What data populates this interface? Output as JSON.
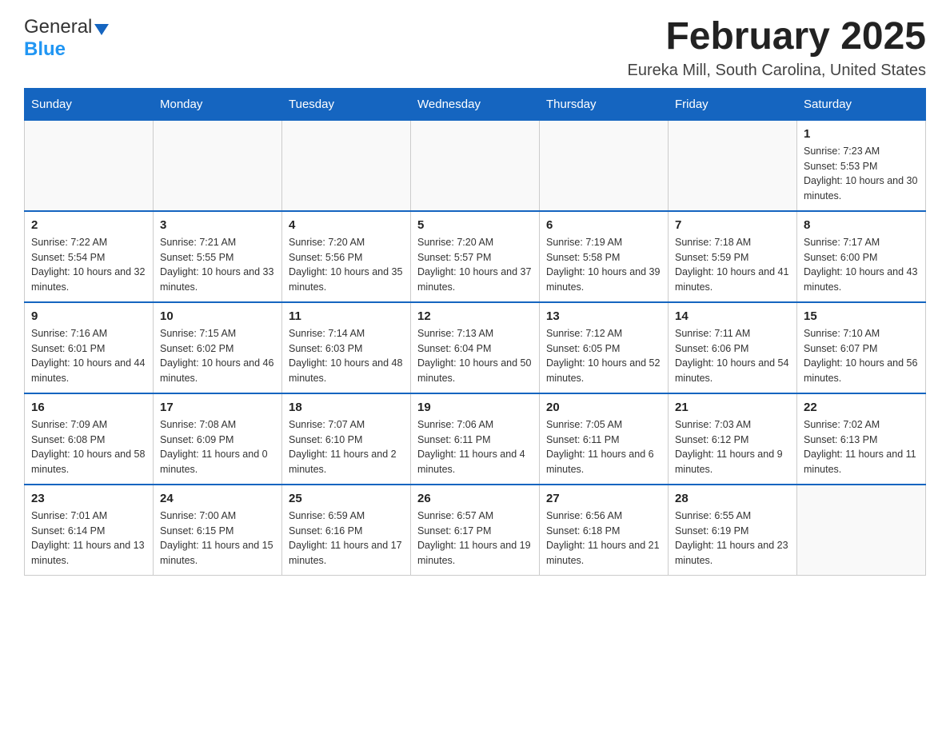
{
  "header": {
    "month_title": "February 2025",
    "location": "Eureka Mill, South Carolina, United States",
    "logo_general": "General",
    "logo_blue": "Blue"
  },
  "weekdays": [
    "Sunday",
    "Monday",
    "Tuesday",
    "Wednesday",
    "Thursday",
    "Friday",
    "Saturday"
  ],
  "weeks": [
    [
      {
        "day": "",
        "sunrise": "",
        "sunset": "",
        "daylight": ""
      },
      {
        "day": "",
        "sunrise": "",
        "sunset": "",
        "daylight": ""
      },
      {
        "day": "",
        "sunrise": "",
        "sunset": "",
        "daylight": ""
      },
      {
        "day": "",
        "sunrise": "",
        "sunset": "",
        "daylight": ""
      },
      {
        "day": "",
        "sunrise": "",
        "sunset": "",
        "daylight": ""
      },
      {
        "day": "",
        "sunrise": "",
        "sunset": "",
        "daylight": ""
      },
      {
        "day": "1",
        "sunrise": "Sunrise: 7:23 AM",
        "sunset": "Sunset: 5:53 PM",
        "daylight": "Daylight: 10 hours and 30 minutes."
      }
    ],
    [
      {
        "day": "2",
        "sunrise": "Sunrise: 7:22 AM",
        "sunset": "Sunset: 5:54 PM",
        "daylight": "Daylight: 10 hours and 32 minutes."
      },
      {
        "day": "3",
        "sunrise": "Sunrise: 7:21 AM",
        "sunset": "Sunset: 5:55 PM",
        "daylight": "Daylight: 10 hours and 33 minutes."
      },
      {
        "day": "4",
        "sunrise": "Sunrise: 7:20 AM",
        "sunset": "Sunset: 5:56 PM",
        "daylight": "Daylight: 10 hours and 35 minutes."
      },
      {
        "day": "5",
        "sunrise": "Sunrise: 7:20 AM",
        "sunset": "Sunset: 5:57 PM",
        "daylight": "Daylight: 10 hours and 37 minutes."
      },
      {
        "day": "6",
        "sunrise": "Sunrise: 7:19 AM",
        "sunset": "Sunset: 5:58 PM",
        "daylight": "Daylight: 10 hours and 39 minutes."
      },
      {
        "day": "7",
        "sunrise": "Sunrise: 7:18 AM",
        "sunset": "Sunset: 5:59 PM",
        "daylight": "Daylight: 10 hours and 41 minutes."
      },
      {
        "day": "8",
        "sunrise": "Sunrise: 7:17 AM",
        "sunset": "Sunset: 6:00 PM",
        "daylight": "Daylight: 10 hours and 43 minutes."
      }
    ],
    [
      {
        "day": "9",
        "sunrise": "Sunrise: 7:16 AM",
        "sunset": "Sunset: 6:01 PM",
        "daylight": "Daylight: 10 hours and 44 minutes."
      },
      {
        "day": "10",
        "sunrise": "Sunrise: 7:15 AM",
        "sunset": "Sunset: 6:02 PM",
        "daylight": "Daylight: 10 hours and 46 minutes."
      },
      {
        "day": "11",
        "sunrise": "Sunrise: 7:14 AM",
        "sunset": "Sunset: 6:03 PM",
        "daylight": "Daylight: 10 hours and 48 minutes."
      },
      {
        "day": "12",
        "sunrise": "Sunrise: 7:13 AM",
        "sunset": "Sunset: 6:04 PM",
        "daylight": "Daylight: 10 hours and 50 minutes."
      },
      {
        "day": "13",
        "sunrise": "Sunrise: 7:12 AM",
        "sunset": "Sunset: 6:05 PM",
        "daylight": "Daylight: 10 hours and 52 minutes."
      },
      {
        "day": "14",
        "sunrise": "Sunrise: 7:11 AM",
        "sunset": "Sunset: 6:06 PM",
        "daylight": "Daylight: 10 hours and 54 minutes."
      },
      {
        "day": "15",
        "sunrise": "Sunrise: 7:10 AM",
        "sunset": "Sunset: 6:07 PM",
        "daylight": "Daylight: 10 hours and 56 minutes."
      }
    ],
    [
      {
        "day": "16",
        "sunrise": "Sunrise: 7:09 AM",
        "sunset": "Sunset: 6:08 PM",
        "daylight": "Daylight: 10 hours and 58 minutes."
      },
      {
        "day": "17",
        "sunrise": "Sunrise: 7:08 AM",
        "sunset": "Sunset: 6:09 PM",
        "daylight": "Daylight: 11 hours and 0 minutes."
      },
      {
        "day": "18",
        "sunrise": "Sunrise: 7:07 AM",
        "sunset": "Sunset: 6:10 PM",
        "daylight": "Daylight: 11 hours and 2 minutes."
      },
      {
        "day": "19",
        "sunrise": "Sunrise: 7:06 AM",
        "sunset": "Sunset: 6:11 PM",
        "daylight": "Daylight: 11 hours and 4 minutes."
      },
      {
        "day": "20",
        "sunrise": "Sunrise: 7:05 AM",
        "sunset": "Sunset: 6:11 PM",
        "daylight": "Daylight: 11 hours and 6 minutes."
      },
      {
        "day": "21",
        "sunrise": "Sunrise: 7:03 AM",
        "sunset": "Sunset: 6:12 PM",
        "daylight": "Daylight: 11 hours and 9 minutes."
      },
      {
        "day": "22",
        "sunrise": "Sunrise: 7:02 AM",
        "sunset": "Sunset: 6:13 PM",
        "daylight": "Daylight: 11 hours and 11 minutes."
      }
    ],
    [
      {
        "day": "23",
        "sunrise": "Sunrise: 7:01 AM",
        "sunset": "Sunset: 6:14 PM",
        "daylight": "Daylight: 11 hours and 13 minutes."
      },
      {
        "day": "24",
        "sunrise": "Sunrise: 7:00 AM",
        "sunset": "Sunset: 6:15 PM",
        "daylight": "Daylight: 11 hours and 15 minutes."
      },
      {
        "day": "25",
        "sunrise": "Sunrise: 6:59 AM",
        "sunset": "Sunset: 6:16 PM",
        "daylight": "Daylight: 11 hours and 17 minutes."
      },
      {
        "day": "26",
        "sunrise": "Sunrise: 6:57 AM",
        "sunset": "Sunset: 6:17 PM",
        "daylight": "Daylight: 11 hours and 19 minutes."
      },
      {
        "day": "27",
        "sunrise": "Sunrise: 6:56 AM",
        "sunset": "Sunset: 6:18 PM",
        "daylight": "Daylight: 11 hours and 21 minutes."
      },
      {
        "day": "28",
        "sunrise": "Sunrise: 6:55 AM",
        "sunset": "Sunset: 6:19 PM",
        "daylight": "Daylight: 11 hours and 23 minutes."
      },
      {
        "day": "",
        "sunrise": "",
        "sunset": "",
        "daylight": ""
      }
    ]
  ]
}
